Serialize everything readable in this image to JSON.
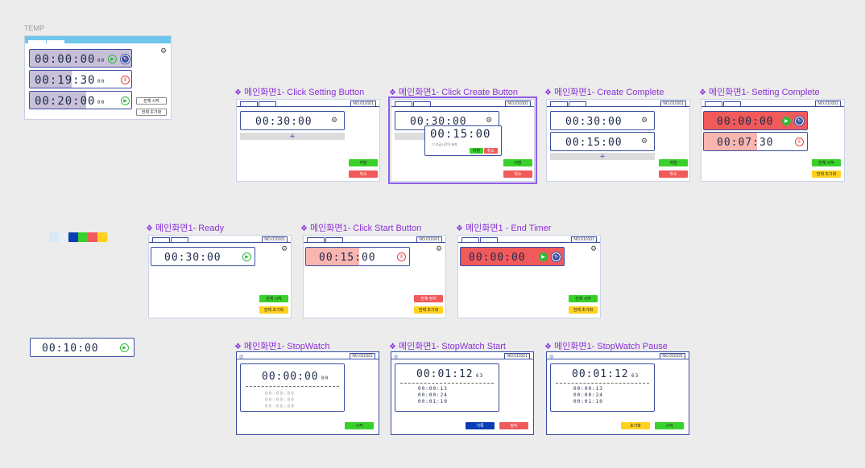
{
  "temp": {
    "title": "TEMP",
    "timers": [
      "00:00:00",
      "00:19:30",
      "00:20:00"
    ],
    "timer_ms": [
      "00",
      "00",
      "00"
    ],
    "start_all": "전체 시작",
    "reset_all": "전체 초기화"
  },
  "screens": {
    "s1": {
      "label": "메인화면1- Click Setting Button",
      "time": "00:30:00",
      "save": "저장",
      "cancel": "취소",
      "no": "NO.010101"
    },
    "s2": {
      "label": "메인화면1- Click Create Button",
      "time": "00:30:00",
      "popup_time": "00:15:00",
      "popup_check": "조금시간이 초과",
      "ok": "저장",
      "cancel": "취소",
      "save": "저장",
      "cancel2": "취소",
      "no": "NO.010101"
    },
    "s3": {
      "label": "메인화면1- Create Complete",
      "time1": "00:30:00",
      "time2": "00:15:00",
      "save": "저장",
      "cancel": "취소",
      "no": "NO.010101"
    },
    "s4": {
      "label": "메인화면1- Setting Complete",
      "time1": "00:00:00",
      "time2": "00:07:30",
      "start_all": "전체 시작",
      "reset_all": "전체 초기화",
      "no": "NO.010101"
    },
    "s5": {
      "label": "메인화면1- Ready",
      "time": "00:30:00",
      "start_all": "전체 시작",
      "reset_all": "전체 초기화",
      "no": "NO.010101"
    },
    "s6": {
      "label": "메인화면1- Click Start Button",
      "time": "00:15:00",
      "stop_all": "전체 정지",
      "reset_all": "전체 초기화",
      "no": "NO.010101"
    },
    "s7": {
      "label": "메인화면1 - End Timer",
      "time": "00:00:00",
      "start_all": "전체 시작",
      "reset_all": "전체 초기화",
      "no": "NO.010101"
    },
    "s8": {
      "label": "메인화면1- StopWatch",
      "time": "00:00:00",
      "ms": "00",
      "laps": [
        "00:00:00",
        "00:00:00",
        "00:00:00"
      ],
      "start": "시작",
      "no": "NO.010101"
    },
    "s9": {
      "label": "메인화면1- StopWatch Start",
      "time": "00:01:12",
      "ms": "63",
      "laps": [
        "00:00:13",
        "00:00:24",
        "00:01:10"
      ],
      "lap_btn": "기록",
      "stop_btn": "정지",
      "no": "NO.010101"
    },
    "s10": {
      "label": "메인화면1- StopWatch Pause",
      "time": "00:01:12",
      "ms": "63",
      "laps": [
        "00:00:13",
        "00:00:24",
        "00:01:10"
      ],
      "reset_btn": "초기화",
      "start_btn": "시작",
      "no": "NO.010101"
    }
  },
  "component": {
    "time": "00:10:00"
  },
  "palette": [
    "#d6e9f5",
    "#e6eef8",
    "#0a3cb4",
    "#38d02a",
    "#f05a5a",
    "#ffd21f"
  ]
}
